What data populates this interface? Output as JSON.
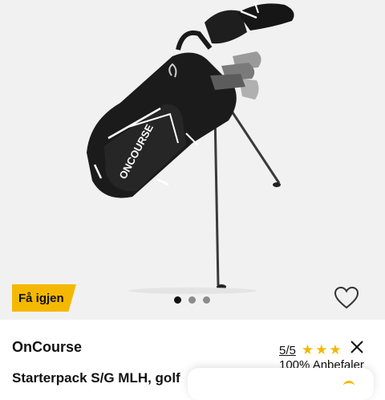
{
  "product": {
    "badge_label": "Få igjen",
    "brand": "OnCourse",
    "title": "Starterpack S/G MLH, golf",
    "bag_print": "ONCOURSE"
  },
  "carousel": {
    "slide_count": 3,
    "active_index": 0
  },
  "rating": {
    "score_label": "5/5",
    "stars_shown": 3,
    "recommend_label": "100% Anbefaler"
  },
  "icons": {
    "favorite": "heart-outline-icon",
    "close": "close-icon",
    "star": "star-icon"
  },
  "colors": {
    "accent": "#f5b800",
    "image_background": "#f1f1f1",
    "text": "#111111"
  }
}
